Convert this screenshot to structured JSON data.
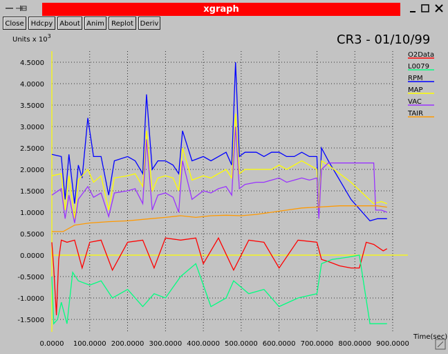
{
  "window": {
    "title": "xgraph",
    "min_icon": "minimize-icon",
    "max_icon": "maximize-icon",
    "close_icon": "close-icon",
    "menu_icon": "window-menu-icon"
  },
  "toolbar": {
    "close": "Close",
    "hdcpy": "Hdcpy",
    "about": "About",
    "anim": "Anim",
    "replot": "Replot",
    "deriv": "Deriv"
  },
  "chart_data": {
    "type": "line",
    "title": "CR3 - 01/10/99",
    "ylabel": "Units x 10",
    "ylabel_exp": "3",
    "xlabel": "Time(sec)",
    "xlim": [
      0,
      900
    ],
    "ylim": [
      -1.75,
      4.75
    ],
    "grid": true,
    "legend_placement": "right",
    "x_ticks": [
      "0.0000",
      "100.0000",
      "200.0000",
      "300.0000",
      "400.0000",
      "500.0000",
      "600.0000",
      "700.0000",
      "800.0000",
      "900.0000"
    ],
    "y_ticks": [
      "4.5000",
      "4.0000",
      "3.5000",
      "3.0000",
      "2.5000",
      "2.0000",
      "1.5000",
      "1.0000",
      "0.5000",
      "0.0000",
      "-0.5000",
      "-1.0000",
      "-1.5000"
    ],
    "series": [
      {
        "name": "O2Data",
        "color": "#ff0000",
        "points": [
          [
            0,
            0.3
          ],
          [
            5,
            -0.3
          ],
          [
            12,
            -1.4
          ],
          [
            18,
            -0.1
          ],
          [
            25,
            0.35
          ],
          [
            40,
            0.3
          ],
          [
            60,
            0.35
          ],
          [
            80,
            -0.3
          ],
          [
            100,
            0.3
          ],
          [
            130,
            0.35
          ],
          [
            160,
            -0.35
          ],
          [
            200,
            0.3
          ],
          [
            240,
            0.35
          ],
          [
            270,
            -0.3
          ],
          [
            300,
            0.4
          ],
          [
            340,
            0.35
          ],
          [
            380,
            0.4
          ],
          [
            400,
            -0.2
          ],
          [
            440,
            0.4
          ],
          [
            480,
            -0.35
          ],
          [
            520,
            0.35
          ],
          [
            560,
            0.3
          ],
          [
            600,
            -0.3
          ],
          [
            650,
            0.35
          ],
          [
            700,
            0.3
          ],
          [
            712,
            -0.1
          ],
          [
            730,
            -0.15
          ],
          [
            760,
            -0.25
          ],
          [
            790,
            -0.3
          ],
          [
            812,
            -0.3
          ],
          [
            830,
            0.3
          ],
          [
            850,
            0.25
          ],
          [
            875,
            0.1
          ],
          [
            885,
            0.15
          ]
        ]
      },
      {
        "name": "L0079",
        "color": "#00ff80",
        "points": [
          [
            0,
            -0.5
          ],
          [
            5,
            -1.6
          ],
          [
            15,
            -1.5
          ],
          [
            25,
            -1.1
          ],
          [
            40,
            -1.6
          ],
          [
            55,
            -0.4
          ],
          [
            70,
            -0.6
          ],
          [
            100,
            -0.7
          ],
          [
            130,
            -0.6
          ],
          [
            160,
            -1.0
          ],
          [
            200,
            -0.8
          ],
          [
            240,
            -1.2
          ],
          [
            270,
            -0.9
          ],
          [
            300,
            -1.0
          ],
          [
            340,
            -0.5
          ],
          [
            380,
            -0.2
          ],
          [
            400,
            -0.7
          ],
          [
            420,
            -1.2
          ],
          [
            460,
            -1.0
          ],
          [
            480,
            -0.6
          ],
          [
            520,
            -0.9
          ],
          [
            560,
            -0.8
          ],
          [
            600,
            -1.2
          ],
          [
            650,
            -1.0
          ],
          [
            700,
            -0.9
          ],
          [
            712,
            -0.2
          ],
          [
            740,
            -0.1
          ],
          [
            780,
            -0.05
          ],
          [
            812,
            0.0
          ],
          [
            840,
            -1.6
          ],
          [
            885,
            -1.6
          ]
        ]
      },
      {
        "name": "RPM",
        "color": "#0000ff",
        "points": [
          [
            0,
            2.35
          ],
          [
            25,
            2.3
          ],
          [
            35,
            1.3
          ],
          [
            45,
            2.35
          ],
          [
            60,
            1.2
          ],
          [
            70,
            2.1
          ],
          [
            80,
            1.8
          ],
          [
            95,
            3.2
          ],
          [
            110,
            2.3
          ],
          [
            130,
            2.3
          ],
          [
            150,
            1.4
          ],
          [
            165,
            2.2
          ],
          [
            200,
            2.3
          ],
          [
            220,
            2.2
          ],
          [
            240,
            1.9
          ],
          [
            250,
            3.75
          ],
          [
            265,
            2.0
          ],
          [
            280,
            2.2
          ],
          [
            300,
            2.2
          ],
          [
            320,
            2.1
          ],
          [
            335,
            1.9
          ],
          [
            345,
            2.9
          ],
          [
            370,
            2.2
          ],
          [
            400,
            2.3
          ],
          [
            420,
            2.2
          ],
          [
            440,
            2.3
          ],
          [
            460,
            2.4
          ],
          [
            475,
            2.1
          ],
          [
            485,
            4.5
          ],
          [
            495,
            2.3
          ],
          [
            510,
            2.4
          ],
          [
            540,
            2.4
          ],
          [
            560,
            2.3
          ],
          [
            580,
            2.4
          ],
          [
            600,
            2.4
          ],
          [
            620,
            2.3
          ],
          [
            640,
            2.3
          ],
          [
            660,
            2.4
          ],
          [
            680,
            2.3
          ],
          [
            700,
            2.3
          ],
          [
            705,
            0.9
          ],
          [
            712,
            2.5
          ],
          [
            730,
            2.2
          ],
          [
            790,
            1.3
          ],
          [
            840,
            0.8
          ],
          [
            860,
            0.85
          ],
          [
            885,
            0.85
          ]
        ]
      },
      {
        "name": "MAP",
        "color": "#ffff00",
        "points": [
          [
            0,
            1.85
          ],
          [
            25,
            1.9
          ],
          [
            35,
            1.05
          ],
          [
            45,
            1.85
          ],
          [
            60,
            0.85
          ],
          [
            70,
            1.75
          ],
          [
            95,
            2.0
          ],
          [
            110,
            1.7
          ],
          [
            130,
            1.85
          ],
          [
            150,
            1.05
          ],
          [
            165,
            1.8
          ],
          [
            200,
            1.85
          ],
          [
            220,
            1.9
          ],
          [
            240,
            1.6
          ],
          [
            250,
            2.9
          ],
          [
            265,
            1.5
          ],
          [
            280,
            1.8
          ],
          [
            300,
            1.85
          ],
          [
            320,
            1.8
          ],
          [
            335,
            1.5
          ],
          [
            345,
            2.5
          ],
          [
            370,
            1.75
          ],
          [
            400,
            1.85
          ],
          [
            420,
            1.8
          ],
          [
            440,
            1.9
          ],
          [
            460,
            2.0
          ],
          [
            475,
            1.8
          ],
          [
            485,
            3.3
          ],
          [
            495,
            1.9
          ],
          [
            510,
            2.0
          ],
          [
            540,
            2.0
          ],
          [
            560,
            2.0
          ],
          [
            580,
            2.0
          ],
          [
            600,
            2.1
          ],
          [
            620,
            2.0
          ],
          [
            640,
            2.1
          ],
          [
            660,
            2.2
          ],
          [
            680,
            2.1
          ],
          [
            700,
            2.0
          ],
          [
            705,
            1.0
          ],
          [
            712,
            2.2
          ],
          [
            730,
            2.1
          ],
          [
            790,
            1.7
          ],
          [
            850,
            1.2
          ],
          [
            870,
            1.25
          ],
          [
            885,
            1.2
          ]
        ]
      },
      {
        "name": "VAC",
        "color": "#9933ff",
        "points": [
          [
            0,
            1.4
          ],
          [
            25,
            1.55
          ],
          [
            35,
            0.85
          ],
          [
            45,
            1.4
          ],
          [
            60,
            0.75
          ],
          [
            70,
            1.3
          ],
          [
            95,
            1.6
          ],
          [
            110,
            1.35
          ],
          [
            130,
            1.45
          ],
          [
            150,
            0.9
          ],
          [
            165,
            1.45
          ],
          [
            200,
            1.5
          ],
          [
            220,
            1.55
          ],
          [
            240,
            1.2
          ],
          [
            250,
            2.7
          ],
          [
            265,
            1.05
          ],
          [
            280,
            1.4
          ],
          [
            300,
            1.45
          ],
          [
            320,
            1.35
          ],
          [
            335,
            1.0
          ],
          [
            345,
            2.2
          ],
          [
            370,
            1.3
          ],
          [
            400,
            1.5
          ],
          [
            420,
            1.45
          ],
          [
            440,
            1.55
          ],
          [
            460,
            1.6
          ],
          [
            475,
            1.4
          ],
          [
            485,
            3.0
          ],
          [
            495,
            1.55
          ],
          [
            510,
            1.65
          ],
          [
            540,
            1.7
          ],
          [
            560,
            1.7
          ],
          [
            580,
            1.75
          ],
          [
            600,
            1.8
          ],
          [
            620,
            1.7
          ],
          [
            640,
            1.75
          ],
          [
            660,
            1.8
          ],
          [
            680,
            1.75
          ],
          [
            700,
            1.8
          ],
          [
            705,
            0.85
          ],
          [
            712,
            2.0
          ],
          [
            730,
            2.15
          ],
          [
            790,
            2.15
          ],
          [
            850,
            2.15
          ],
          [
            855,
            1.05
          ],
          [
            870,
            1.05
          ],
          [
            885,
            1.0
          ]
        ]
      },
      {
        "name": "TAIR",
        "color": "#ff9900",
        "points": [
          [
            0,
            0.55
          ],
          [
            30,
            0.55
          ],
          [
            60,
            0.7
          ],
          [
            100,
            0.75
          ],
          [
            150,
            0.78
          ],
          [
            200,
            0.8
          ],
          [
            260,
            0.85
          ],
          [
            300,
            0.88
          ],
          [
            340,
            0.92
          ],
          [
            380,
            0.88
          ],
          [
            420,
            0.92
          ],
          [
            460,
            0.93
          ],
          [
            500,
            0.92
          ],
          [
            540,
            0.95
          ],
          [
            580,
            1.0
          ],
          [
            620,
            1.05
          ],
          [
            660,
            1.1
          ],
          [
            700,
            1.12
          ],
          [
            760,
            1.15
          ],
          [
            820,
            1.15
          ],
          [
            860,
            1.15
          ],
          [
            885,
            1.12
          ]
        ]
      }
    ]
  }
}
